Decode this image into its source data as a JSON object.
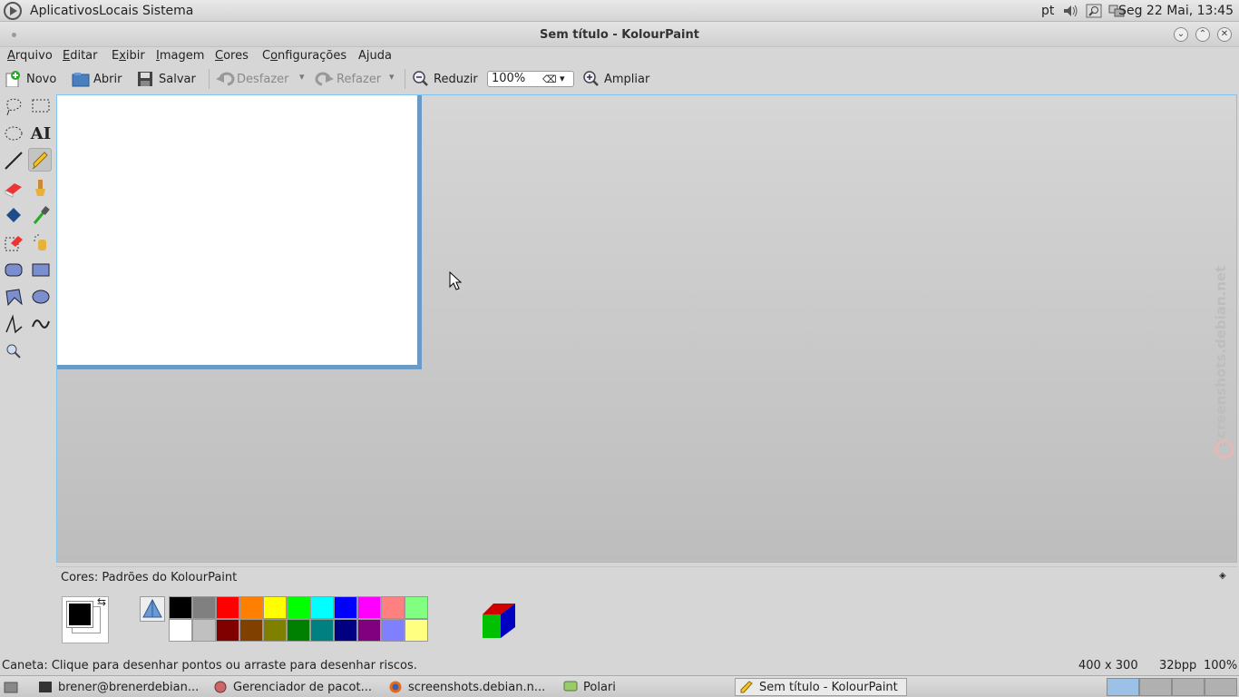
{
  "top_panel": {
    "menus": [
      "Aplicativos",
      "Locais",
      "Sistema"
    ],
    "lang": "pt",
    "clock": "Seg 22 Mai, 13:45"
  },
  "window": {
    "title": "Sem título - KolourPaint"
  },
  "menubar": [
    {
      "label": "Arquivo",
      "accel": "A",
      "rest": "rquivo"
    },
    {
      "label": "Editar",
      "accel": "E",
      "rest": "ditar"
    },
    {
      "label": "Exibir",
      "accel": "x",
      "pre": "E",
      "rest": "ibir"
    },
    {
      "label": "Imagem",
      "accel": "I",
      "rest": "magem"
    },
    {
      "label": "Cores",
      "accel": "C",
      "rest": "ores"
    },
    {
      "label": "Configurações",
      "accel": "o",
      "pre": "C",
      "rest": "nfigurações"
    },
    {
      "label": "Ajuda",
      "accel": "j",
      "pre": "A",
      "rest": "uda"
    }
  ],
  "toolbar": {
    "new": "Novo",
    "open": "Abrir",
    "save": "Salvar",
    "undo": "Desfazer",
    "redo": "Refazer",
    "zoom_out": "Reduzir",
    "zoom_value": "100%",
    "zoom_in": "Ampliar"
  },
  "colors_panel": {
    "title": "Cores: Padrões do KolourPaint",
    "foreground": "#000000",
    "background": "#ffffff",
    "palette_row1": [
      "#000000",
      "#808080",
      "#ff0000",
      "#ff8000",
      "#ffff00",
      "#00ff00",
      "#00ffff",
      "#0000ff",
      "#ff00ff",
      "#ff8080",
      "#80ff80"
    ],
    "palette_row2": [
      "#ffffff",
      "#c0c0c0",
      "#800000",
      "#804000",
      "#808000",
      "#008000",
      "#008080",
      "#000080",
      "#800080",
      "#8080ff",
      "#ffff80"
    ]
  },
  "statusbar": {
    "message": "Caneta: Clique para desenhar pontos ou arraste para desenhar riscos.",
    "size": "400 x 300",
    "depth": "32bpp",
    "zoom": "100%"
  },
  "watermark": "screenshots.debian.net",
  "taskbar": {
    "tasks": [
      "brener@brenerdebian...",
      "Gerenciador de pacot...",
      "screenshots.debian.n...",
      "Polari",
      "Sem título - KolourPaint"
    ]
  }
}
